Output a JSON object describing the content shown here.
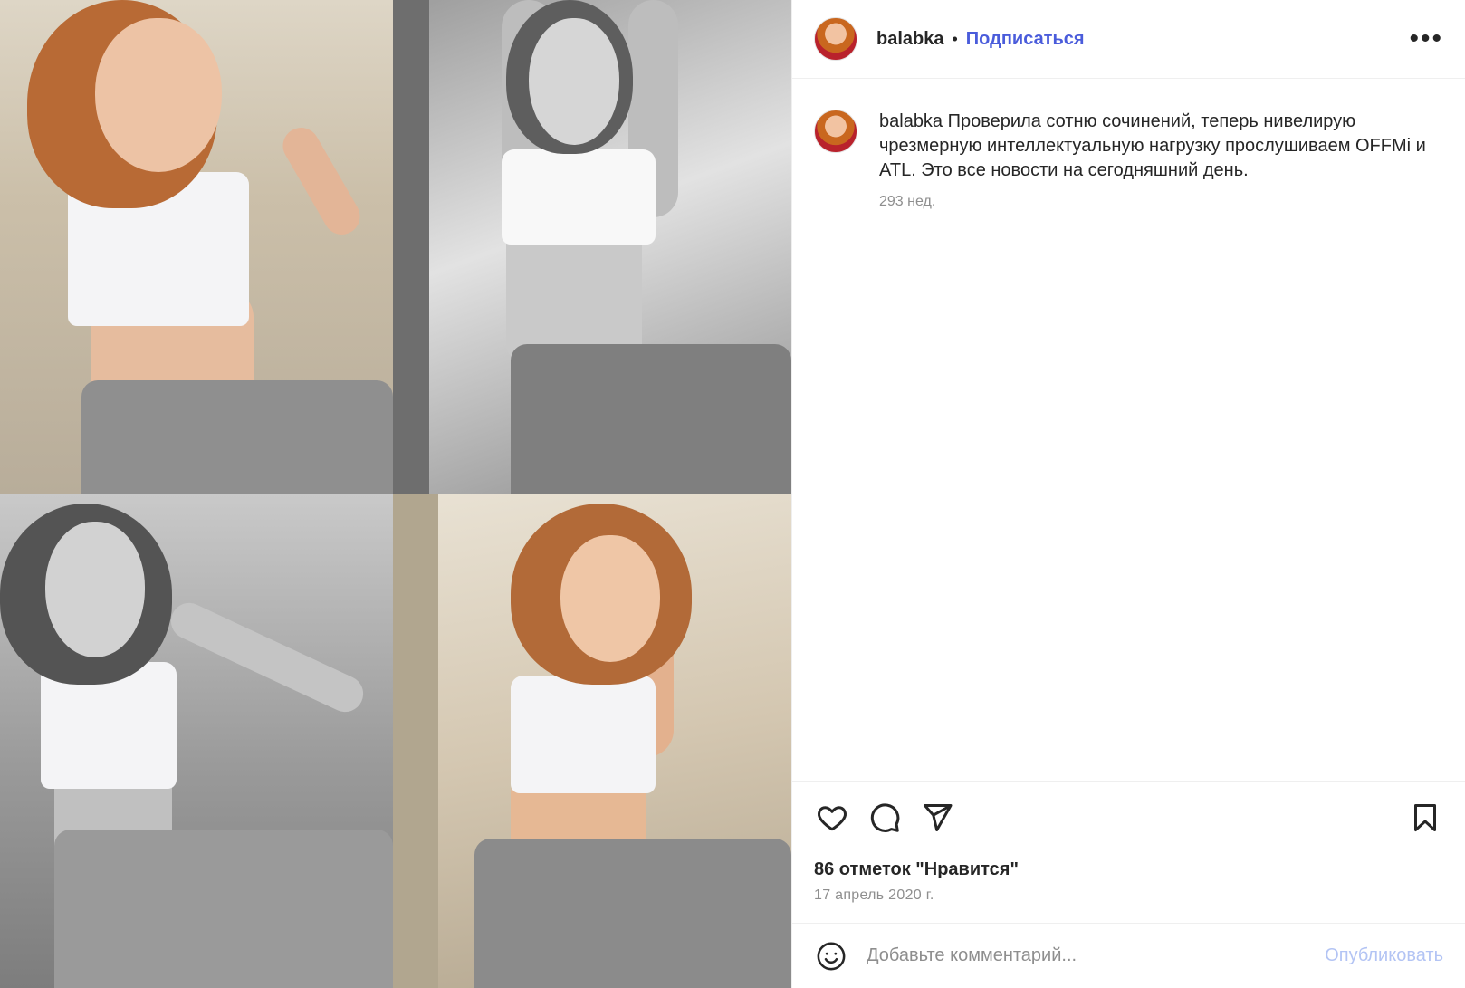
{
  "post": {
    "username": "balabka",
    "follow_label": "Подписаться",
    "more_icon": "more-horizontal-icon",
    "caption_user": "balabka",
    "caption_text": "Проверила сотню сочинений, теперь нивелирую чрезмерную интеллектуальную нагрузку прослушиваем OFFMi и ATL. Это все новости на сегодняшний день.",
    "caption_age": "293 нед.",
    "likes": "86 отметок \"Нравится\"",
    "date": "17 апрель 2020 г.",
    "comment_placeholder": "Добавьте комментарий...",
    "publish_label": "Опубликовать",
    "icons": {
      "like": "heart-icon",
      "comment": "comment-icon",
      "share": "send-icon",
      "save": "bookmark-icon",
      "emoji": "emoji-icon"
    },
    "colors": {
      "accent": "#4a5cdb",
      "publish_disabled": "#b3c4f4",
      "secondary_text": "#8e8e8e"
    },
    "photos": [
      "photo-top-left",
      "photo-top-right",
      "photo-bottom-left",
      "photo-bottom-right"
    ]
  }
}
